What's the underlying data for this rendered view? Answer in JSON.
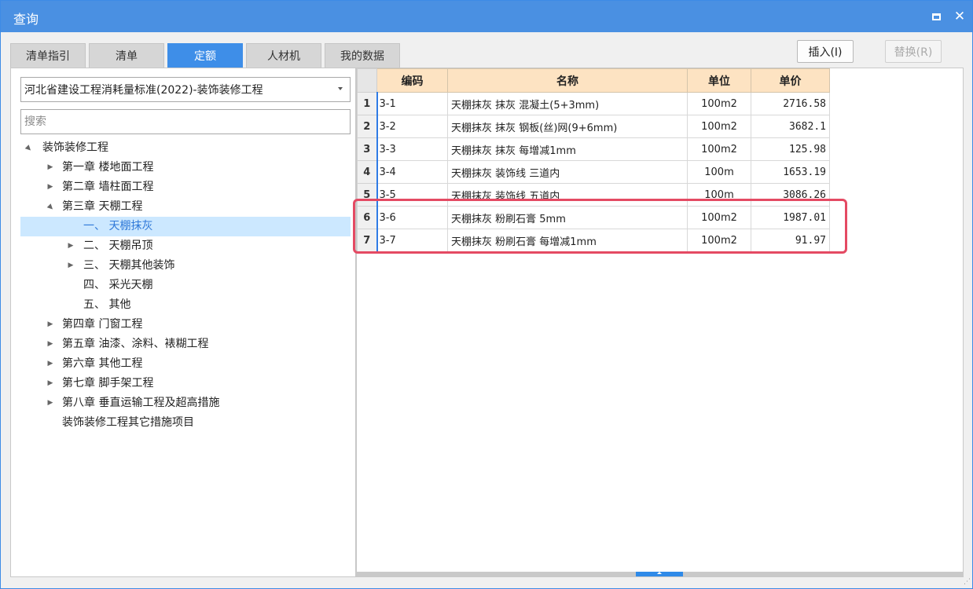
{
  "window": {
    "title": "查询",
    "maximize_icon": "maximize-icon",
    "close_icon": "close-icon",
    "close_glyph": "✕"
  },
  "tabs": [
    {
      "label": "清单指引",
      "active": false
    },
    {
      "label": "清单",
      "active": false
    },
    {
      "label": "定额",
      "active": true
    },
    {
      "label": "人材机",
      "active": false
    },
    {
      "label": "我的数据",
      "active": false
    }
  ],
  "actions": {
    "insert_label": "插入(I)",
    "replace_label": "替换(R)"
  },
  "library": {
    "selected": "河北省建设工程消耗量标准(2022)-装饰装修工程"
  },
  "search": {
    "placeholder": "搜索",
    "value": ""
  },
  "tree": [
    {
      "label": "装饰装修工程",
      "level": 0,
      "toggle": "▲",
      "selected": false
    },
    {
      "label": "第一章 楼地面工程",
      "level": 1,
      "toggle": "▶",
      "selected": false
    },
    {
      "label": "第二章 墙柱面工程",
      "level": 1,
      "toggle": "▶",
      "selected": false
    },
    {
      "label": "第三章 天棚工程",
      "level": 1,
      "toggle": "▲",
      "selected": false
    },
    {
      "label": "一、 天棚抹灰",
      "level": 2,
      "toggle": "",
      "selected": true
    },
    {
      "label": "二、 天棚吊顶",
      "level": 2,
      "toggle": "▶",
      "selected": false
    },
    {
      "label": "三、 天棚其他装饰",
      "level": 2,
      "toggle": "▶",
      "selected": false
    },
    {
      "label": "四、 采光天棚",
      "level": 2,
      "toggle": "",
      "selected": false
    },
    {
      "label": "五、 其他",
      "level": 2,
      "toggle": "",
      "selected": false
    },
    {
      "label": "第四章 门窗工程",
      "level": 1,
      "toggle": "▶",
      "selected": false
    },
    {
      "label": "第五章 油漆、涂料、裱糊工程",
      "level": 1,
      "toggle": "▶",
      "selected": false
    },
    {
      "label": "第六章 其他工程",
      "level": 1,
      "toggle": "▶",
      "selected": false
    },
    {
      "label": "第七章 脚手架工程",
      "level": 1,
      "toggle": "▶",
      "selected": false
    },
    {
      "label": "第八章 垂直运输工程及超高措施",
      "level": 1,
      "toggle": "▶",
      "selected": false
    },
    {
      "label": "装饰装修工程其它措施项目",
      "level": 1,
      "toggle": "",
      "selected": false
    }
  ],
  "grid": {
    "columns": [
      "编码",
      "名称",
      "单位",
      "单价"
    ],
    "rows": [
      {
        "num": "1",
        "code": "3-1",
        "name": "天棚抹灰 抹灰 混凝土(5+3mm)",
        "unit": "100m2",
        "price": "2716.58"
      },
      {
        "num": "2",
        "code": "3-2",
        "name": "天棚抹灰 抹灰 钢板(丝)网(9+6mm)",
        "unit": "100m2",
        "price": "3682.1"
      },
      {
        "num": "3",
        "code": "3-3",
        "name": "天棚抹灰 抹灰 每增减1mm",
        "unit": "100m2",
        "price": "125.98"
      },
      {
        "num": "4",
        "code": "3-4",
        "name": "天棚抹灰 装饰线 三道内",
        "unit": "100m",
        "price": "1653.19"
      },
      {
        "num": "5",
        "code": "3-5",
        "name": "天棚抹灰 装饰线 五道内",
        "unit": "100m",
        "price": "3086.26"
      },
      {
        "num": "6",
        "code": "3-6",
        "name": "天棚抹灰 粉刷石膏 5mm",
        "unit": "100m2",
        "price": "1987.01"
      },
      {
        "num": "7",
        "code": "3-7",
        "name": "天棚抹灰 粉刷石膏 每增减1mm",
        "unit": "100m2",
        "price": "91.97"
      }
    ],
    "highlighted_rows": [
      "6",
      "7"
    ],
    "highlight_color": "#e44a63"
  },
  "colors": {
    "accent": "#4a90e2",
    "active_tab": "#3e8ee8",
    "header_bg": "#fde3c2",
    "selection_bg": "#cce8ff"
  }
}
